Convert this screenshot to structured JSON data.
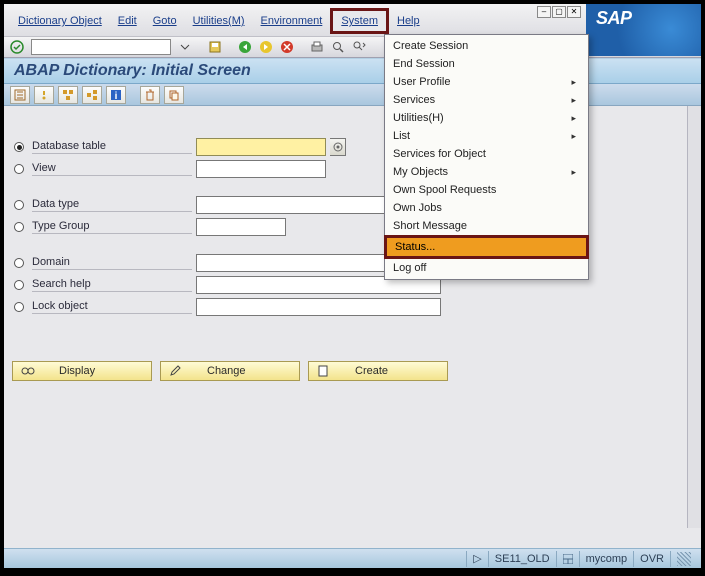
{
  "window": {
    "logo": "SAP"
  },
  "menu": {
    "items": [
      {
        "label": "Dictionary Object",
        "highlighted": false
      },
      {
        "label": "Edit",
        "highlighted": false
      },
      {
        "label": "Goto",
        "highlighted": false
      },
      {
        "label": "Utilities(M)",
        "highlighted": false
      },
      {
        "label": "Environment",
        "highlighted": false
      },
      {
        "label": "System",
        "highlighted": true
      },
      {
        "label": "Help",
        "highlighted": false
      }
    ]
  },
  "command_field": {
    "value": ""
  },
  "page_title": "ABAP Dictionary: Initial Screen",
  "options": {
    "group1": [
      {
        "label": "Database table",
        "selected": true,
        "yellow": true,
        "value": ""
      },
      {
        "label": "View",
        "selected": false,
        "yellow": false,
        "value": ""
      }
    ],
    "group2": [
      {
        "label": "Data type",
        "selected": false,
        "wide": true,
        "value": ""
      },
      {
        "label": "Type Group",
        "selected": false,
        "wide": false,
        "value": ""
      }
    ],
    "group3": [
      {
        "label": "Domain",
        "selected": false,
        "wide": true,
        "value": ""
      },
      {
        "label": "Search help",
        "selected": false,
        "wide": true,
        "value": ""
      },
      {
        "label": "Lock object",
        "selected": false,
        "wide": true,
        "value": ""
      }
    ]
  },
  "actions": {
    "display": "Display",
    "change": "Change",
    "create": "Create"
  },
  "dropdown": {
    "items": [
      {
        "label": "Create Session",
        "submenu": false
      },
      {
        "label": "End Session",
        "submenu": false
      },
      {
        "label": "User Profile",
        "submenu": true
      },
      {
        "label": "Services",
        "submenu": true
      },
      {
        "label": "Utilities(H)",
        "submenu": true
      },
      {
        "label": "List",
        "submenu": true
      },
      {
        "label": "Services for Object",
        "submenu": false
      },
      {
        "label": "My Objects",
        "submenu": true
      },
      {
        "label": "Own Spool Requests",
        "submenu": false
      },
      {
        "label": "Own Jobs",
        "submenu": false
      },
      {
        "label": "Short Message",
        "submenu": false
      },
      {
        "label": "Status...",
        "submenu": false,
        "highlighted": true
      },
      {
        "label": "Log off",
        "submenu": false
      }
    ]
  },
  "status": {
    "tcode": "SE11_OLD",
    "system": "mycomp",
    "mode": "OVR"
  },
  "icon_glyphs": {
    "green_check": "✓",
    "back": "◀",
    "save": "💾",
    "arrow_r": "▶"
  }
}
